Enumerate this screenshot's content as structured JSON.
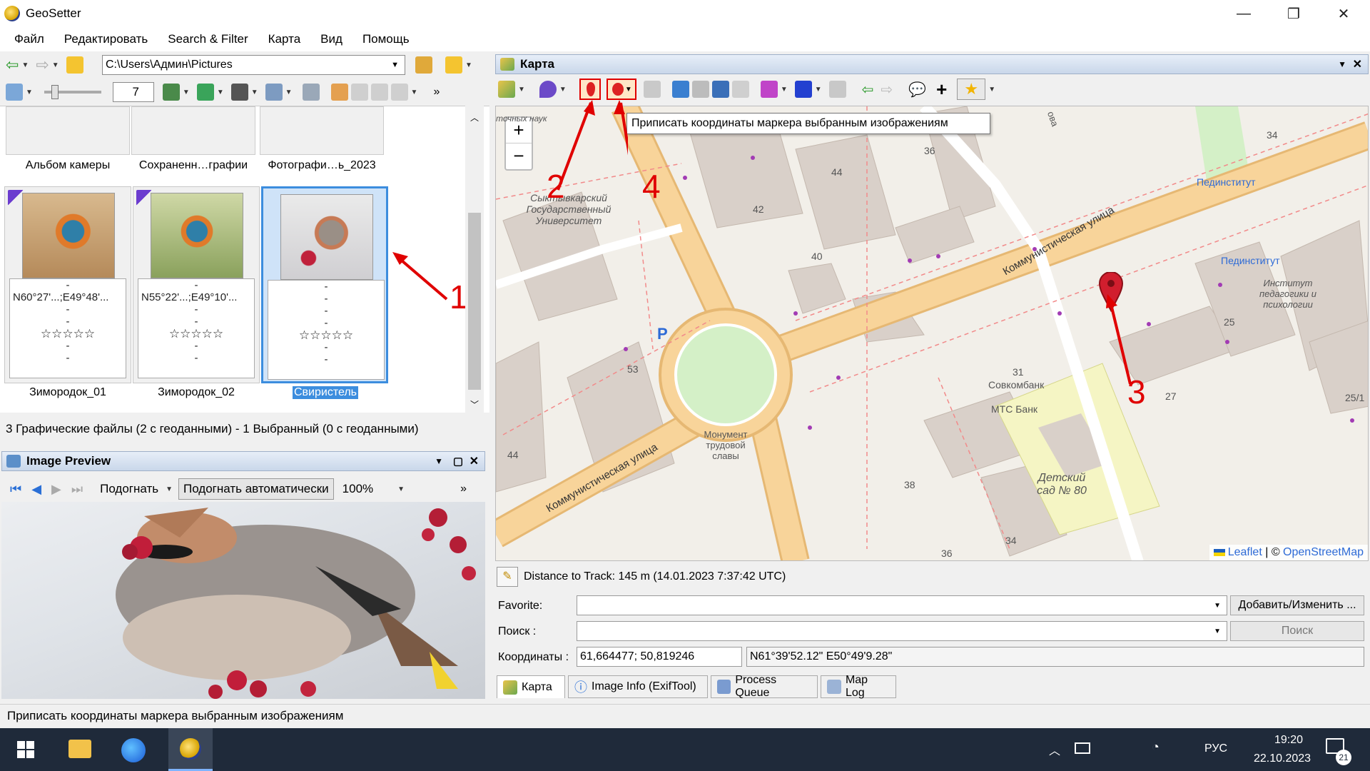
{
  "app": {
    "title": "GeoSetter"
  },
  "menu": [
    "Файл",
    "Редактировать",
    "Search & Filter",
    "Карта",
    "Вид",
    "Помощь"
  ],
  "toolbar": {
    "path": "C:\\Users\\Админ\\Pictures",
    "zoom_value": "7"
  },
  "folders": [
    "Альбом камеры",
    "Сохраненн…графии",
    "Фотографи…ь_2023"
  ],
  "images": [
    {
      "coords": "N60°27'...;E49°48'...",
      "name": "Зимородок_01",
      "dash": "-",
      "stars": "☆☆☆☆☆"
    },
    {
      "coords": "N55°22'...;E49°10'...",
      "name": "Зимородок_02",
      "dash": "-",
      "stars": "☆☆☆☆☆"
    },
    {
      "coords": "-",
      "name": "Свиристель",
      "dash": "-",
      "stars": "☆☆☆☆☆"
    }
  ],
  "status_files": "3 Графические файлы   (2 с геоданными)   - 1 Выбранный   (0 с геоданными)",
  "preview_panel": {
    "title": "Image Preview",
    "fit_label": "Подогнать",
    "fit_auto_label": "Подогнать автоматически",
    "zoom": "100%"
  },
  "map_panel": {
    "title": "Карта",
    "tooltip": "Приписать координаты маркера выбранным изображениям",
    "attribution_leaflet": "Leaflet",
    "attribution_sep": " | © ",
    "attribution_osm": "OpenStreetMap",
    "zoom_in": "+",
    "zoom_out": "−",
    "labels": {
      "street1": "Коммунистическая улица",
      "street2": "Коммунистическая улица",
      "univ": "Сыктывкарский Государственный Университет",
      "univ_prefix": "точных наук",
      "monument": "Монумент трудовой славы",
      "kindergarten": "Детский сад № 80",
      "sovcom": "Совкомбанк",
      "mts": "МТС Банк",
      "pedinst1": "Пединститут",
      "pedinst2": "Пединститут",
      "institute": "Институт педагогики и психологии",
      "parking": "P",
      "street_top": "ова",
      "numbers": [
        "34",
        "36",
        "44",
        "42",
        "40",
        "53",
        "31",
        "25",
        "27",
        "25/1",
        "38",
        "34",
        "44",
        "36"
      ]
    }
  },
  "annotations": [
    "1",
    "2",
    "3",
    "4"
  ],
  "form": {
    "track": "Distance to Track: 145 m (14.01.2023 7:37:42 UTC)",
    "favorite_label": "Favorite:",
    "favorite_value": "",
    "add_button": "Добавить/Изменить ...",
    "search_label": "Поиск :",
    "search_value": "",
    "search_button": "Поиск",
    "coords_label": "Координаты :",
    "coords_decimal": "61,664477; 50,819246",
    "coords_dms": "N61°39'52.12\" E50°49'9.28\""
  },
  "tabs": [
    "Карта",
    "Image Info (ExifTool)",
    "Process Queue",
    "Map Log"
  ],
  "statusbar": "Приписать координаты маркера выбранным изображениям",
  "taskbar": {
    "lang": "РУС",
    "time": "19:20",
    "date": "22.10.2023",
    "notif_count": "21"
  },
  "colors": {
    "accent": "#3c8dde",
    "annotation": "#e00000",
    "road_major": "#f8d49a",
    "green": "#d4f0c7",
    "kindergarten": "#f5f5c4"
  }
}
